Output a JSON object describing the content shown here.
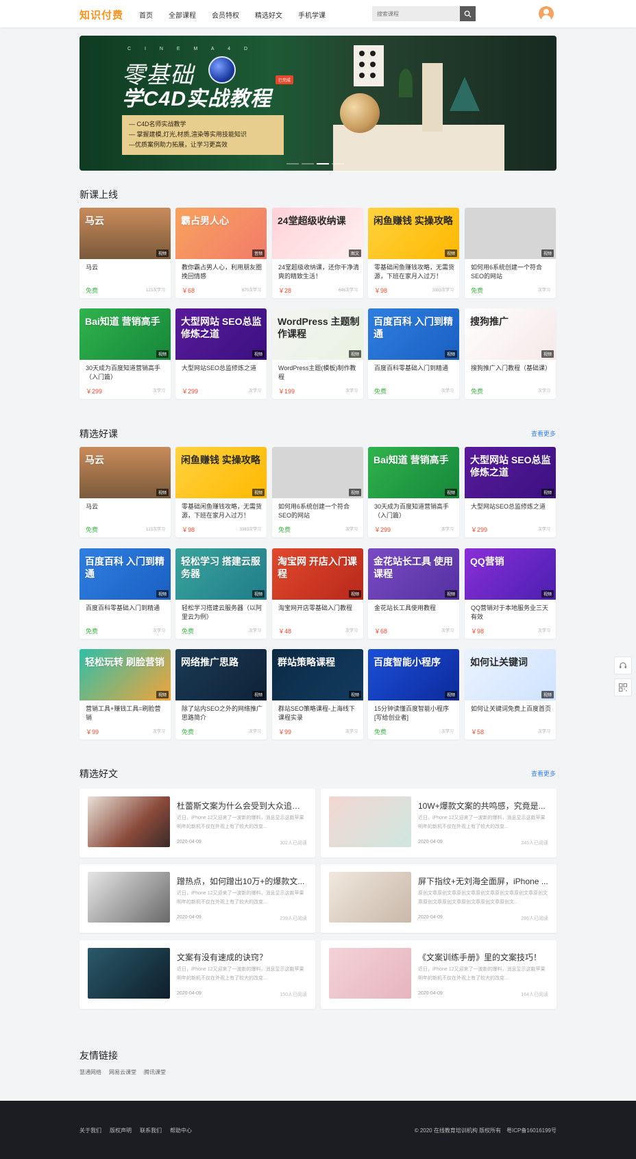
{
  "header": {
    "logo": "知识付费",
    "nav": [
      "首页",
      "全部课程",
      "会员特权",
      "精选好文",
      "手机学课"
    ],
    "search_placeholder": "搜索课程"
  },
  "banner": {
    "subtitle": "C I N E M A 4 D",
    "title_line1": "零基础",
    "title_line2": "学C4D实战教程",
    "tag": "已完成",
    "bullets": [
      "— C4D名师实战教学",
      "— 掌握建模,灯光,材质,渲染等实用技能知识",
      "—优质案例助力拓展，让学习更高效"
    ]
  },
  "sections": {
    "new": "新课上线",
    "featured": "精选好课",
    "articles": "精选好文",
    "links": "友情链接",
    "more": "查看更多"
  },
  "new_courses": [
    {
      "title": "马云",
      "badge": "视频",
      "price": "免费",
      "learn": "123次学习",
      "thumb": "马云",
      "free": true
    },
    {
      "title": "教你霸占男人心，利用朋友圈挽回情感",
      "badge": "音频",
      "price": "￥68",
      "learn": "670次学习",
      "thumb": "霸占男人心",
      "free": false
    },
    {
      "title": "24堂超级收纳课，还你干净清爽的精致生活！",
      "badge": "图文",
      "price": "￥28",
      "learn": "646次学习",
      "thumb": "24堂超级收纳课",
      "free": false
    },
    {
      "title": "零基础闲鱼赚钱攻略，无需货源，下班在家月入过万！",
      "badge": "视频",
      "price": "￥98",
      "learn": "3383次学习",
      "thumb": "闲鱼赚钱 实操攻略",
      "free": false
    },
    {
      "title": "如何用6系统创建一个符合SEO的网站",
      "badge": "视频",
      "price": "免费",
      "learn": "次学习",
      "thumb": "",
      "free": true
    },
    {
      "title": "30天成为百度知道营销高手（入门篇）",
      "badge": "视频",
      "price": "￥299",
      "learn": "次学习",
      "thumb": "Bai知道 营销高手",
      "free": false
    },
    {
      "title": "大型网站SEO总监修炼之道",
      "badge": "视频",
      "price": "￥299",
      "learn": "次学习",
      "thumb": "大型网站 SEO总监修炼之道",
      "free": false
    },
    {
      "title": "WordPress主题(模板)制作教程",
      "badge": "视频",
      "price": "￥199",
      "learn": "次学习",
      "thumb": "WordPress 主题制作课程",
      "free": false
    },
    {
      "title": "百度百科零基础入门到精通",
      "badge": "视频",
      "price": "免费",
      "learn": "次学习",
      "thumb": "百度百科 入门到精通",
      "free": true
    },
    {
      "title": "搜狗推广入门教程（基础课）",
      "badge": "视频",
      "price": "免费",
      "learn": "次学习",
      "thumb": "搜狗推广",
      "free": true
    }
  ],
  "featured_courses": [
    {
      "title": "马云",
      "badge": "视频",
      "price": "免费",
      "learn": "123次学习",
      "thumb": "马云",
      "free": true
    },
    {
      "title": "零基础闲鱼赚钱攻略，无需货源，下班在家月入过万！",
      "badge": "视频",
      "price": "￥98",
      "learn": "3383次学习",
      "thumb": "闲鱼赚钱 实操攻略",
      "free": false
    },
    {
      "title": "如何用6系统创建一个符合SEO的网站",
      "badge": "视频",
      "price": "免费",
      "learn": "次学习",
      "thumb": "",
      "free": true
    },
    {
      "title": "30天成为百度知道营销高手（入门篇）",
      "badge": "视频",
      "price": "￥299",
      "learn": "次学习",
      "thumb": "Bai知道 营销高手",
      "free": false
    },
    {
      "title": "大型网站SEO总监修炼之道",
      "badge": "视频",
      "price": "￥299",
      "learn": "次学习",
      "thumb": "大型网站 SEO总监修炼之道",
      "free": false
    },
    {
      "title": "百度百科零基础入门到精通",
      "badge": "视频",
      "price": "免费",
      "learn": "次学习",
      "thumb": "百度百科 入门到精通",
      "free": true
    },
    {
      "title": "轻松学习搭建云服务器（以阿里云为例）",
      "badge": "视频",
      "price": "免费",
      "learn": "次学习",
      "thumb": "轻松学习 搭建云服务器",
      "free": true
    },
    {
      "title": "淘宝网开店零基础入门教程",
      "badge": "视频",
      "price": "￥48",
      "learn": "次学习",
      "thumb": "淘宝网 开店入门课程",
      "free": false
    },
    {
      "title": "金花站长工具使用教程",
      "badge": "视频",
      "price": "￥68",
      "learn": "次学习",
      "thumb": "金花站长工具 使用课程",
      "free": false
    },
    {
      "title": "QQ营销对于本地服务业三天有效",
      "badge": "视频",
      "price": "￥98",
      "learn": "次学习",
      "thumb": "QQ营销",
      "free": false
    },
    {
      "title": "营销工具+赚钱工具=刷脸营销",
      "badge": "视频",
      "price": "￥99",
      "learn": "次学习",
      "thumb": "轻松玩转 刷脸营销",
      "free": false
    },
    {
      "title": "除了站内SEO之外的网络推广思路简介",
      "badge": "视频",
      "price": "免费",
      "learn": "次学习",
      "thumb": "网络推广思路",
      "free": true
    },
    {
      "title": "群站SEO策略课程-上海线下课程实录",
      "badge": "视频",
      "price": "￥99",
      "learn": "次学习",
      "thumb": "群站策略课程",
      "free": false
    },
    {
      "title": "15分钟读懂百度智能小程序[写给创业者]",
      "badge": "视频",
      "price": "免费",
      "learn": "次学习",
      "thumb": "百度智能小程序",
      "free": true
    },
    {
      "title": "如何让关键词免费上百度首页",
      "badge": "视频",
      "price": "￥58",
      "learn": "次学习",
      "thumb": "如何让关键词",
      "free": false
    }
  ],
  "articles": [
    {
      "title": "杜蕾斯文案为什么会受到大众追捧？",
      "desc": "近日，iPhone 12又迎来了一波新的爆料，消息显示这款苹果明年的新机不仅在外观上有了较大的改变...",
      "date": "2020-04-09",
      "read": "302人已阅读"
    },
    {
      "title": "10W+爆款文案的共鸣感，究竟是...",
      "desc": "近日，iPhone 12又迎来了一波新的爆料，消息显示这款苹果明年的新机不仅在外观上有了较大的改变...",
      "date": "2020-04-09",
      "read": "245人已阅读"
    },
    {
      "title": "蹭热点，如何蹭出10万+的爆款文...",
      "desc": "近日，iPhone 12又迎来了一波新的爆料，消息显示这款苹果明年的新机不仅在外观上有了较大的改变...",
      "date": "2020-04-09",
      "read": "239人已阅读"
    },
    {
      "title": "屏下指纹+无刘海全面屏，iPhone ...",
      "desc": "原创文章原创文章原创文章原创文章原创文章原创文章原创文章原创文章原创文章原创文章原创文章原创文...",
      "date": "2020-04-09",
      "read": "286人已阅读"
    },
    {
      "title": "文案有没有速成的诀窍？",
      "desc": "近日，iPhone 12又迎来了一波新的爆料，消息显示这款苹果明年的新机不仅在外观上有了较大的改变...",
      "date": "2020-04-09",
      "read": "150人已阅读"
    },
    {
      "title": "《文案训练手册》里的文案技巧！",
      "desc": "近日，iPhone 12又迎来了一波新的爆料，消息显示这款苹果明年的新机不仅在外观上有了较大的改变...",
      "date": "2020-04-09",
      "read": "164人已阅读"
    }
  ],
  "friend_links": [
    "慧通网络",
    "网易云课堂",
    "腾讯课堂"
  ],
  "footer": {
    "links": [
      "关于我们",
      "版权声明",
      "联系我们",
      "帮助中心"
    ],
    "copyright": "© 2020 在线教育培训机构 版权所有　粤ICP备16016199号"
  },
  "colors": {
    "accent": "#f7931e",
    "price": "#ef4a2f",
    "free": "#43b549",
    "link": "#3a85e0",
    "footer_bg": "#1c1d22"
  }
}
